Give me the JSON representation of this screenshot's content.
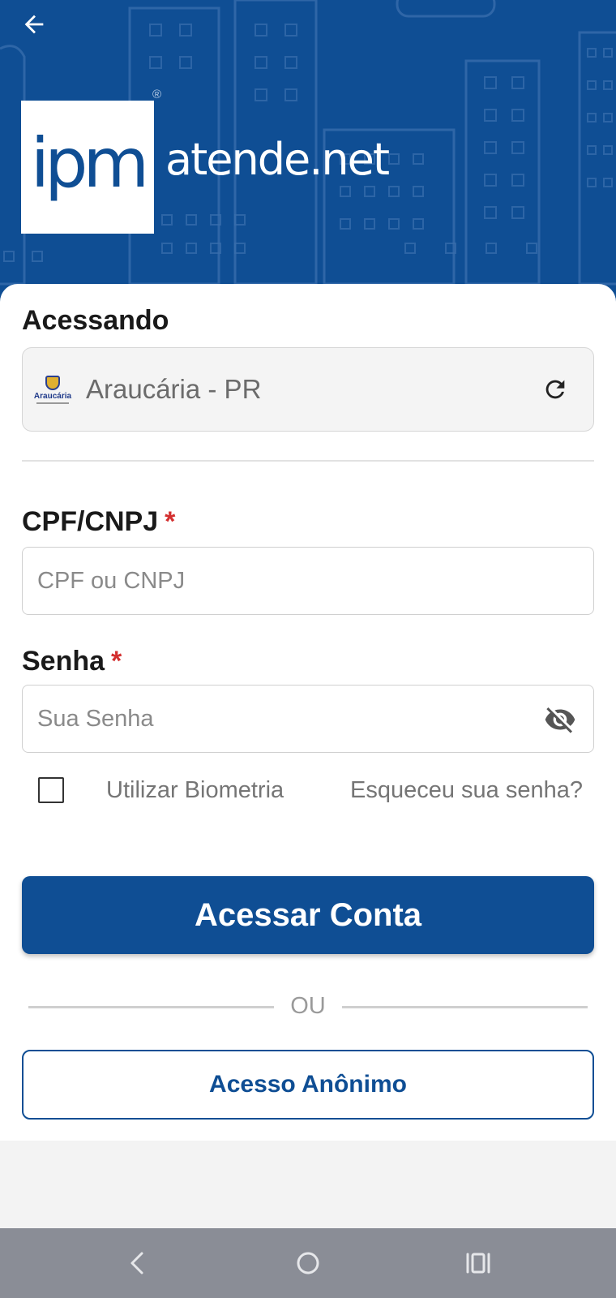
{
  "header": {
    "logo_text": "ipm",
    "brand_text": "atende.net",
    "registered_mark": "®",
    "back_icon": "arrow-left-icon"
  },
  "accessing": {
    "label": "Acessando",
    "city_logo_text": "Araucária",
    "city_name": "Araucária - PR",
    "refresh_icon": "refresh-icon"
  },
  "cpf": {
    "label": "CPF/CNPJ",
    "required_mark": "*",
    "placeholder": "CPF ou CNPJ",
    "value": ""
  },
  "password": {
    "label": "Senha",
    "required_mark": "*",
    "placeholder": "Sua Senha",
    "value": "",
    "toggle_icon": "eye-off-icon"
  },
  "options": {
    "biometric_label": "Utilizar Biometria",
    "biometric_checked": false,
    "forgot_label": "Esqueceu sua senha?"
  },
  "actions": {
    "login_label": "Acessar Conta",
    "or_label": "OU",
    "anonymous_label": "Acesso Anônimo"
  },
  "colors": {
    "primary": "#0f4e94",
    "required": "#d32f2f",
    "navbar": "#8a8d96"
  },
  "navbar": {
    "back_icon": "nav-back-icon",
    "home_icon": "nav-home-icon",
    "recents_icon": "nav-recents-icon"
  }
}
